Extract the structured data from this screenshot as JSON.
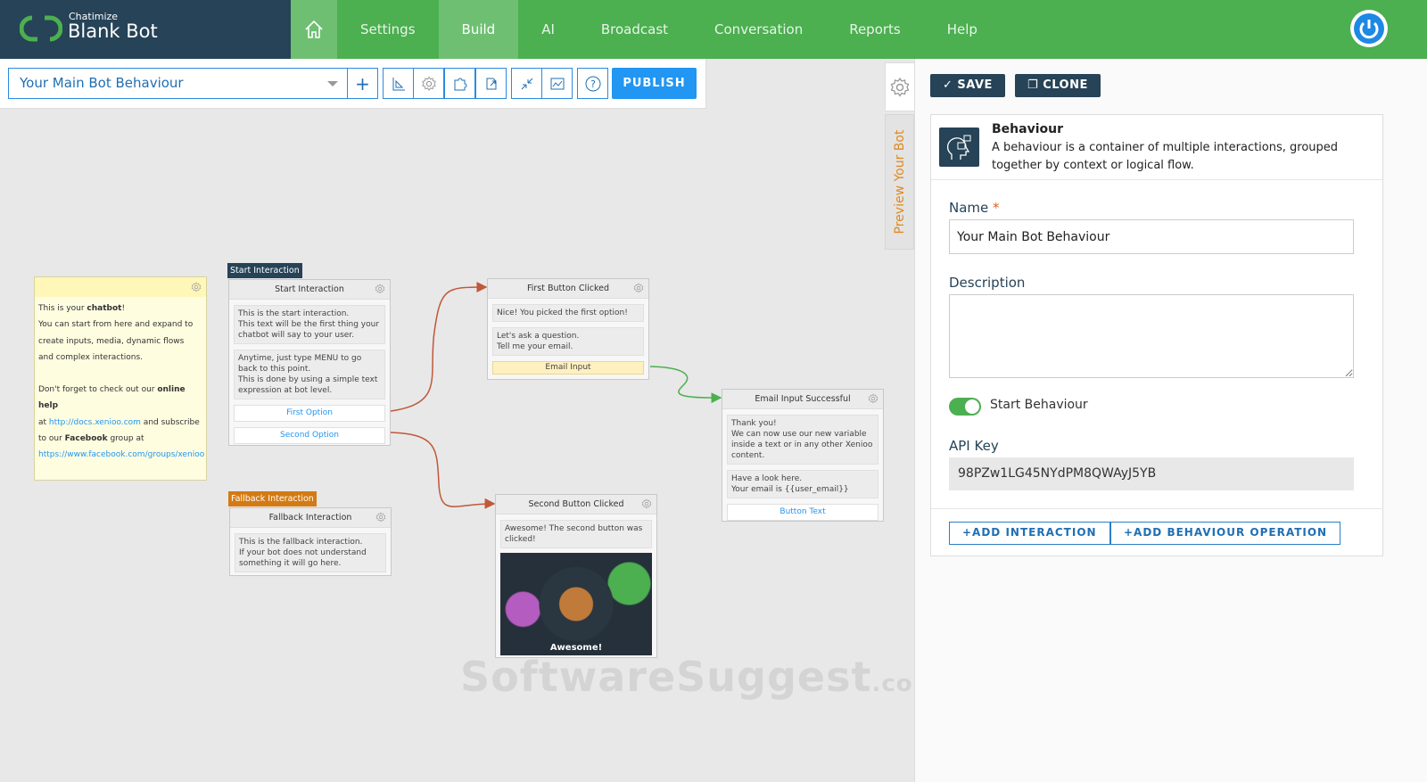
{
  "brand": {
    "company": "Chatimize",
    "bot_name": "Blank Bot"
  },
  "nav": {
    "items": [
      "Settings",
      "Build",
      "AI",
      "Broadcast",
      "Conversation",
      "Reports",
      "Help"
    ],
    "active": "Build"
  },
  "toolbar": {
    "behaviour_select": "Your Main Bot Behaviour",
    "publish_label": "PUBLISH"
  },
  "note": {
    "line1_pre": "This is your ",
    "line1_bold": "chatbot",
    "line1_post": "!",
    "line2": "You can start from here and expand to\ncreate inputs, media, dynamic flows\nand complex interactions.",
    "line3_pre": "Don't forget to check out our ",
    "line3_bold": "online help",
    "line4_pre": "at ",
    "docs_link": "http://docs.xenioo.com",
    "line4_post": " and subscribe",
    "line5_pre": "to our ",
    "line5_bold": "Facebook",
    "line5_post": " group at",
    "fb_link": "https://www.facebook.com/groups/xenioo"
  },
  "nodes": {
    "start": {
      "tag": "Start Interaction",
      "title": "Start Interaction",
      "messages": [
        "This is the start interaction.\nThis text will be the first thing your chatbot will say to your user.",
        "Anytime, just type MENU to go back to this point.\nThis is done by using a simple text expression at bot level."
      ],
      "buttons": [
        "First Option",
        "Second Option"
      ]
    },
    "fallback": {
      "tag": "Fallback Interaction",
      "title": "Fallback Interaction",
      "messages": [
        "This is the fallback interaction.\nIf your bot does not understand something it will go here."
      ]
    },
    "first": {
      "title": "First Button Clicked",
      "messages": [
        "Nice! You picked the first option!",
        "Let's ask a question.\nTell me your email."
      ],
      "input": "Email Input"
    },
    "second": {
      "title": "Second Button Clicked",
      "messages": [
        "Awesome! The second button was clicked!"
      ],
      "image_caption": "Awesome!"
    },
    "email": {
      "title": "Email Input Successful",
      "messages": [
        "Thank you!\nWe can now use our new variable inside a text or in any other Xenioo content.",
        "Have a look here.\nYour email is {{user_email}}"
      ],
      "buttons": [
        "Button Text"
      ]
    }
  },
  "side": {
    "preview_label": "Preview Your Bot"
  },
  "panel": {
    "save_label": "SAVE",
    "clone_label": "CLONE",
    "behaviour_title": "Behaviour",
    "behaviour_desc": "A behaviour is a container of multiple interactions, grouped together by context or logical flow.",
    "name_label": "Name",
    "required_mark": "*",
    "name_value": "Your Main Bot Behaviour",
    "description_label": "Description",
    "description_value": "",
    "start_behaviour_label": "Start Behaviour",
    "start_behaviour_on": true,
    "api_key_label": "API Key",
    "api_key_value": "98PZw1LG45NYdPM8QWAyJ5YB",
    "add_interaction_label": "+ADD INTERACTION",
    "add_operation_label": "+ADD BEHAVIOUR OPERATION"
  },
  "watermark": {
    "text": "SoftwareSuggest",
    ".com": ".com"
  },
  "colors": {
    "header_green": "#4caf50",
    "brand_navy": "#264357",
    "accent_blue": "#2196f3",
    "connector_red": "#c0583a",
    "connector_green": "#4caf50",
    "fallback_orange": "#d47a12"
  }
}
